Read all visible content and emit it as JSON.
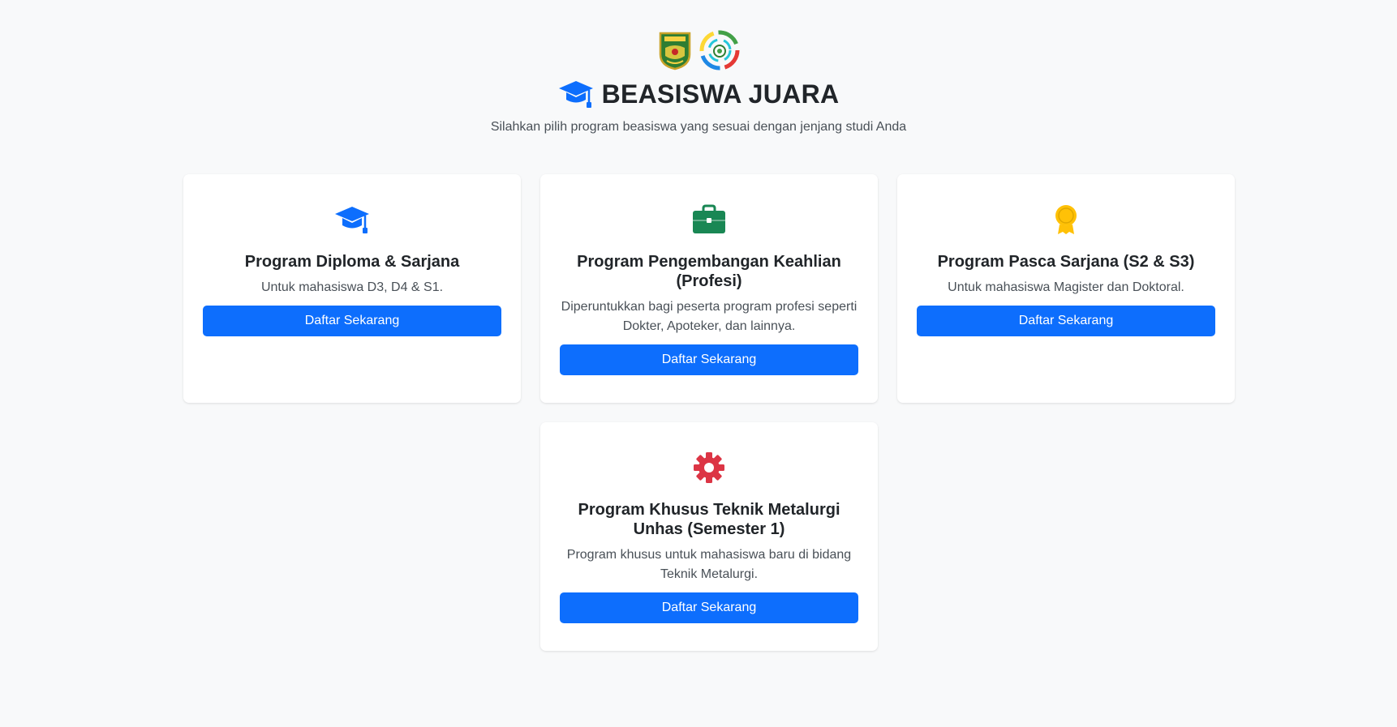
{
  "header": {
    "title": "BEASISWA JUARA",
    "subtitle": "Silahkan pilih program beasiswa yang sesuai dengan jenjang studi Anda",
    "title_icon": "graduation-cap-icon",
    "accent_color": "#0d6efd"
  },
  "cards": [
    {
      "icon": "graduation-cap-icon",
      "icon_color": "#0d6efd",
      "title": "Program Diploma & Sarjana",
      "description": "Untuk mahasiswa D3, D4 & S1.",
      "button_label": "Daftar Sekarang"
    },
    {
      "icon": "briefcase-icon",
      "icon_color": "#198754",
      "title": "Program Pengembangan Keahlian (Profesi)",
      "description": "Diperuntukkan bagi peserta program profesi seperti Dokter, Apoteker, dan lainnya.",
      "button_label": "Daftar Sekarang"
    },
    {
      "icon": "award-icon",
      "icon_color": "#ffc107",
      "title": "Program Pasca Sarjana (S2 & S3)",
      "description": "Untuk mahasiswa Magister dan Doktoral.",
      "button_label": "Daftar Sekarang"
    },
    {
      "icon": "gear-icon",
      "icon_color": "#dc3545",
      "title": "Program Khusus Teknik Metalurgi Unhas (Semester 1)",
      "description": "Program khusus untuk mahasiswa baru di bidang Teknik Metalurgi.",
      "button_label": "Daftar Sekarang"
    }
  ],
  "colors": {
    "background": "#f8f9fa",
    "button": "#0d6efd",
    "card": "#ffffff"
  }
}
